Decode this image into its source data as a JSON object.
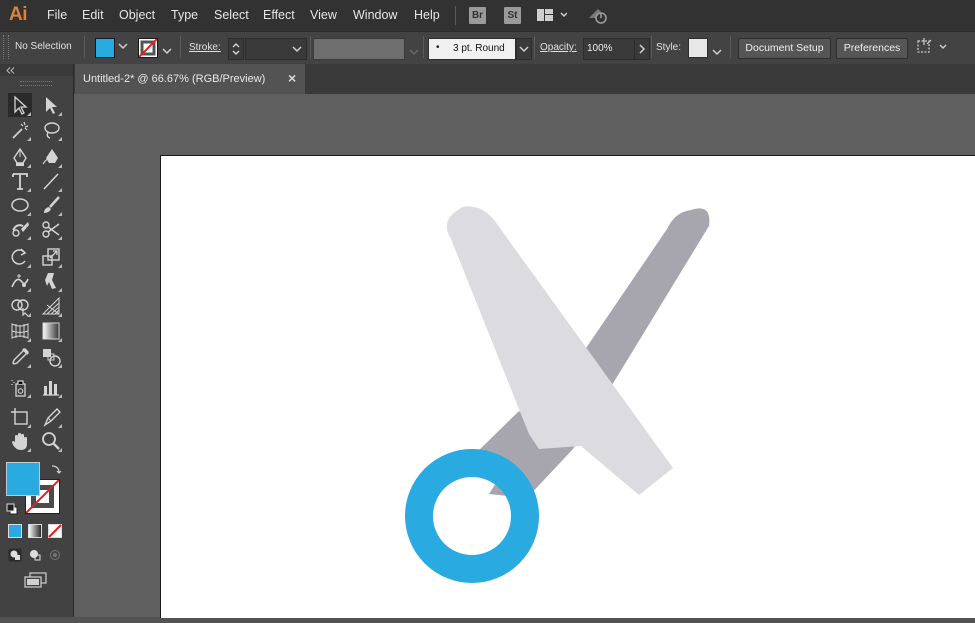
{
  "app": {
    "logo_text": "Ai"
  },
  "menubar": {
    "items": [
      "File",
      "Edit",
      "Object",
      "Type",
      "Select",
      "Effect",
      "View",
      "Window",
      "Help"
    ],
    "badges": {
      "bridge": "Br",
      "stock": "St"
    }
  },
  "controlbar": {
    "selection_label": "No Selection",
    "stroke_label": "Stroke:",
    "brush_value": "3 pt. Round",
    "opacity_label": "Opacity:",
    "opacity_value": "100%",
    "style_label": "Style:",
    "document_setup": "Document Setup",
    "preferences": "Preferences"
  },
  "document": {
    "tab_title": "Untitled-2* @ 66.67% (RGB/Preview)",
    "close": "×"
  },
  "colors": {
    "fill": "#29abe2",
    "accent_orange": "#d8843a",
    "scissor_back_blade": "#a7a6ae",
    "scissor_front_blade": "#dcdbe0",
    "scissor_ring": "#29abe2"
  },
  "tools": [
    "selection-tool",
    "direct-selection-tool",
    "magic-wand-tool",
    "lasso-tool",
    "pen-tool",
    "curvature-tool",
    "type-tool",
    "line-segment-tool",
    "ellipse-tool",
    "paintbrush-tool",
    "shaper-tool",
    "scissors-tool",
    "rotate-tool",
    "scale-tool",
    "width-tool",
    "puppet-warp-tool",
    "shape-builder-tool",
    "perspective-grid-tool",
    "mesh-tool",
    "gradient-tool",
    "eyedropper-tool",
    "blend-tool",
    "symbol-sprayer-tool",
    "column-graph-tool",
    "artboard-tool",
    "slice-tool",
    "hand-tool",
    "zoom-tool"
  ]
}
